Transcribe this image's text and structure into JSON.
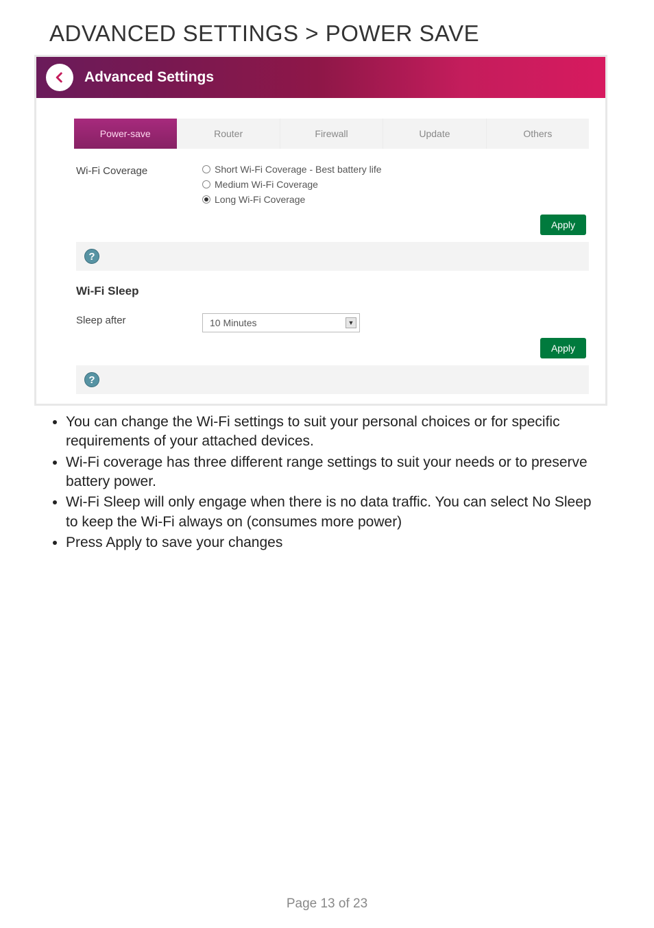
{
  "page_heading": "ADVANCED SETTINGS > POWER SAVE",
  "header": {
    "title": "Advanced Settings"
  },
  "tabs": [
    {
      "label": "Power-save",
      "active": true
    },
    {
      "label": "Router",
      "active": false
    },
    {
      "label": "Firewall",
      "active": false
    },
    {
      "label": "Update",
      "active": false
    },
    {
      "label": "Others",
      "active": false
    }
  ],
  "coverage": {
    "label": "Wi-Fi Coverage",
    "options": [
      {
        "label": "Short Wi-Fi Coverage - Best battery life",
        "selected": false
      },
      {
        "label": "Medium Wi-Fi Coverage",
        "selected": false
      },
      {
        "label": "Long Wi-Fi Coverage",
        "selected": true
      }
    ]
  },
  "apply_label": "Apply",
  "help_glyph": "?",
  "sleep": {
    "section_title": "Wi-Fi Sleep",
    "label": "Sleep after",
    "value": "10 Minutes"
  },
  "bullets": [
    "You can change the Wi-Fi settings to suit your personal choices or for specific requirements of your attached devices.",
    "Wi-Fi coverage has three different range settings to suit your needs or to preserve battery power.",
    "Wi-Fi Sleep will only engage when there is no data traffic. You can select No Sleep to keep the Wi-Fi always on (consumes more power)",
    "Press Apply to save your changes"
  ],
  "footer": "Page 13 of 23"
}
